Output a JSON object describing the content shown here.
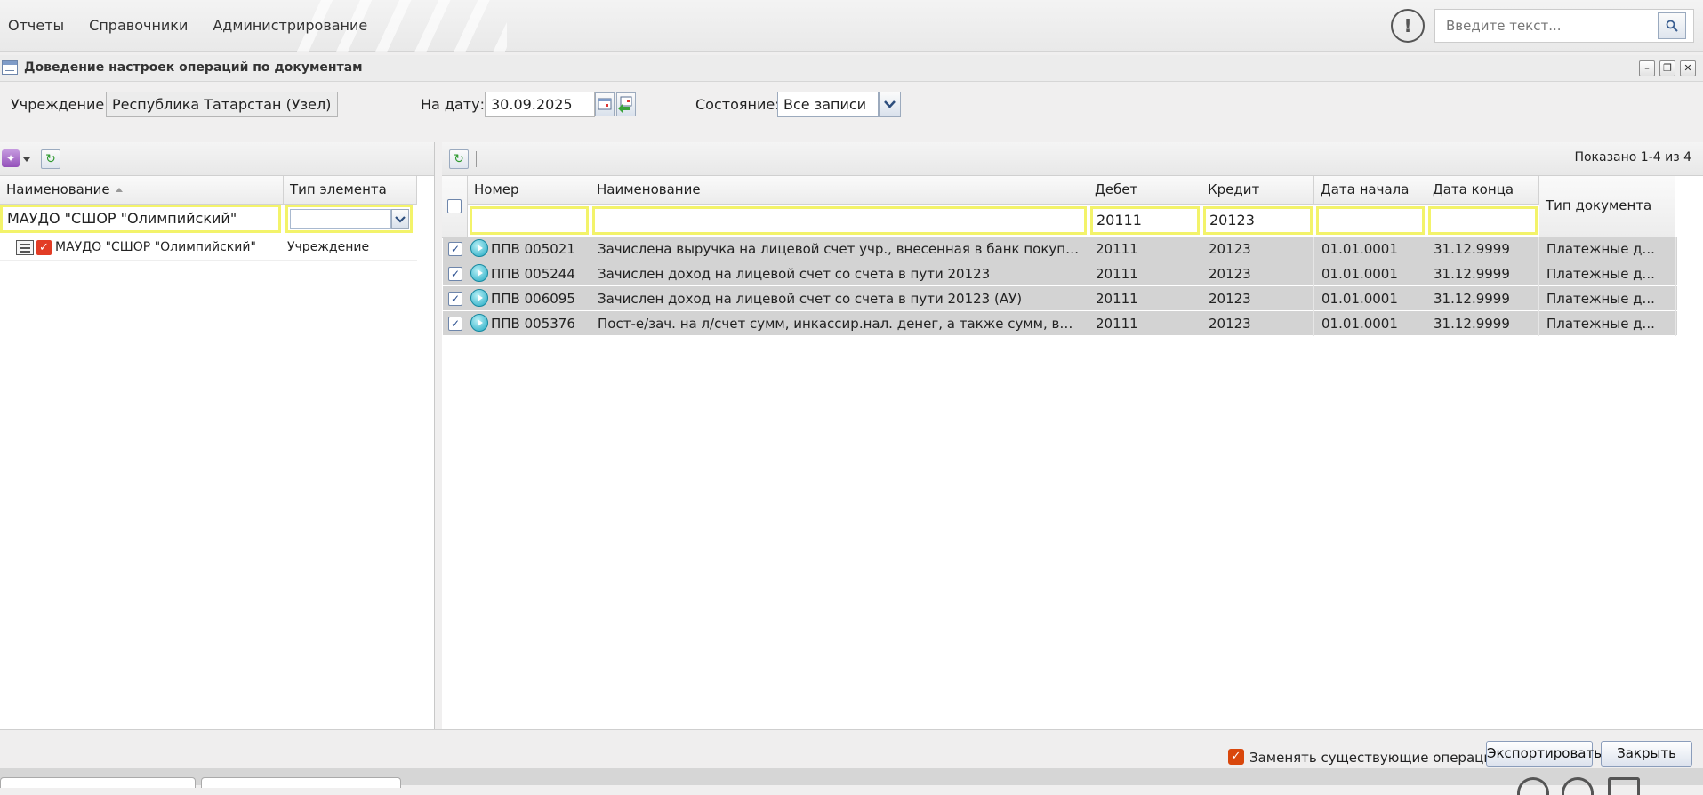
{
  "menu": {
    "items": [
      "Отчеты",
      "Справочники",
      "Администрирование"
    ]
  },
  "search": {
    "placeholder": "Введите текст..."
  },
  "window": {
    "title": "Доведение настроек операций по документам"
  },
  "filters": {
    "institution_label": "Учреждение:",
    "institution_value": "Республика Татарстан (Узел)",
    "date_label": "На дату:",
    "date_value": "30.09.2025",
    "state_label": "Состояние:",
    "state_value": "Все записи"
  },
  "left_grid": {
    "columns": [
      "Наименование",
      "Тип элемента"
    ],
    "filter_name": "МАУДО \"СШОР \"Олимпийский\"",
    "filter_type": "",
    "rows": [
      {
        "name": "МАУДО \"СШОР \"Олимпийский\"",
        "type": "Учреждение",
        "checked": true
      }
    ]
  },
  "right_grid": {
    "shown_text": "Показано 1-4 из 4",
    "columns": [
      "Номер",
      "Наименование",
      "Дебет",
      "Кредит",
      "Дата начала",
      "Дата конца",
      "Тип документа"
    ],
    "filters": {
      "number": "",
      "name": "",
      "debit": "20111",
      "credit": "20123",
      "start": "",
      "end": ""
    },
    "rows": [
      {
        "number": "ППВ 005021",
        "name": "Зачислена выручка на лицевой счет учр., внесенная в банк покупателями ...",
        "debit": "20111",
        "credit": "20123",
        "start": "01.01.0001",
        "end": "31.12.9999",
        "doc_type": "Платежные д...",
        "checked": true
      },
      {
        "number": "ППВ 005244",
        "name": "Зачислен доход на лицевой счет со счета в пути 20123",
        "debit": "20111",
        "credit": "20123",
        "start": "01.01.0001",
        "end": "31.12.9999",
        "doc_type": "Платежные д...",
        "checked": true
      },
      {
        "number": "ППВ 006095",
        "name": "Зачислен доход на лицевой счет со счета в пути 20123 (АУ)",
        "debit": "20111",
        "credit": "20123",
        "start": "01.01.0001",
        "end": "31.12.9999",
        "doc_type": "Платежные д...",
        "checked": true
      },
      {
        "number": "ППВ 005376",
        "name": "Пост-е/зач. на л/счет сумм, инкассир.нал. денег, а также сумм, внесенных ...",
        "debit": "20111",
        "credit": "20123",
        "start": "01.01.0001",
        "end": "31.12.9999",
        "doc_type": "Платежные д...",
        "checked": true
      }
    ]
  },
  "footer": {
    "replace_label": "Заменять существующие операции?",
    "replace_checked": true,
    "export_label": "Экспортировать",
    "close_label": "Закрыть"
  }
}
